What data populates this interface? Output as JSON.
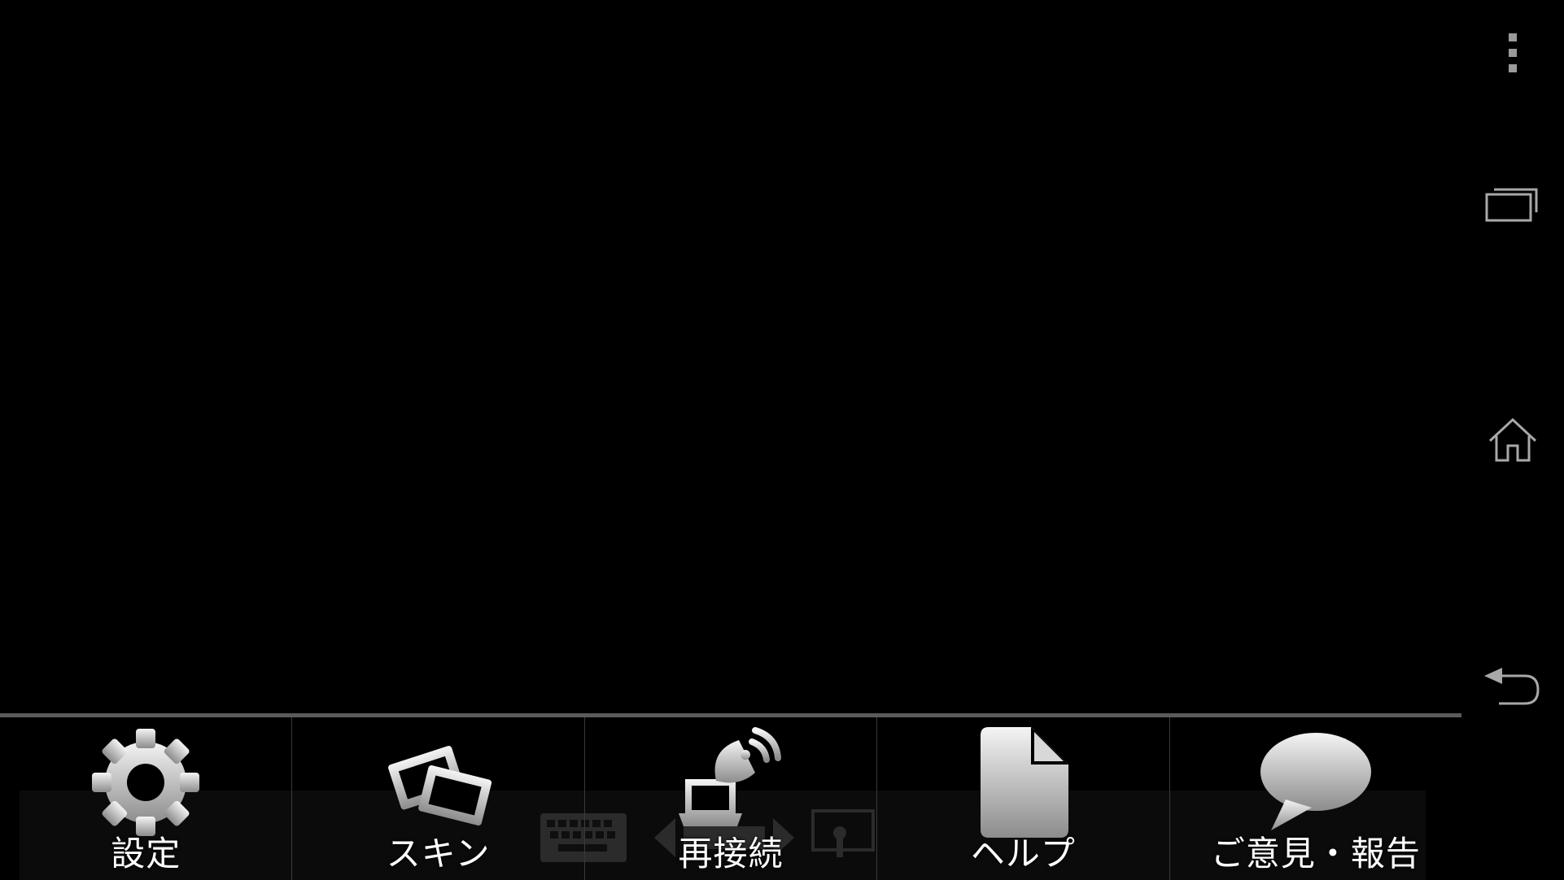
{
  "menu": {
    "items": [
      {
        "label": "設定",
        "icon": "gear-icon"
      },
      {
        "label": "スキン",
        "icon": "skin-cards-icon"
      },
      {
        "label": "再接続",
        "icon": "satellite-dish-laptop-icon"
      },
      {
        "label": "ヘルプ",
        "icon": "document-icon"
      },
      {
        "label": "ご意見・報告",
        "icon": "speech-bubble-icon"
      }
    ]
  },
  "nav_bar": {
    "buttons": [
      "overflow-menu-icon",
      "recent-apps-icon",
      "home-icon",
      "back-icon"
    ]
  },
  "colors": {
    "background": "#000000",
    "divider": "#5b5b5b",
    "icon_light": "#f2f2f2",
    "icon_dark": "#8a8a8a"
  }
}
